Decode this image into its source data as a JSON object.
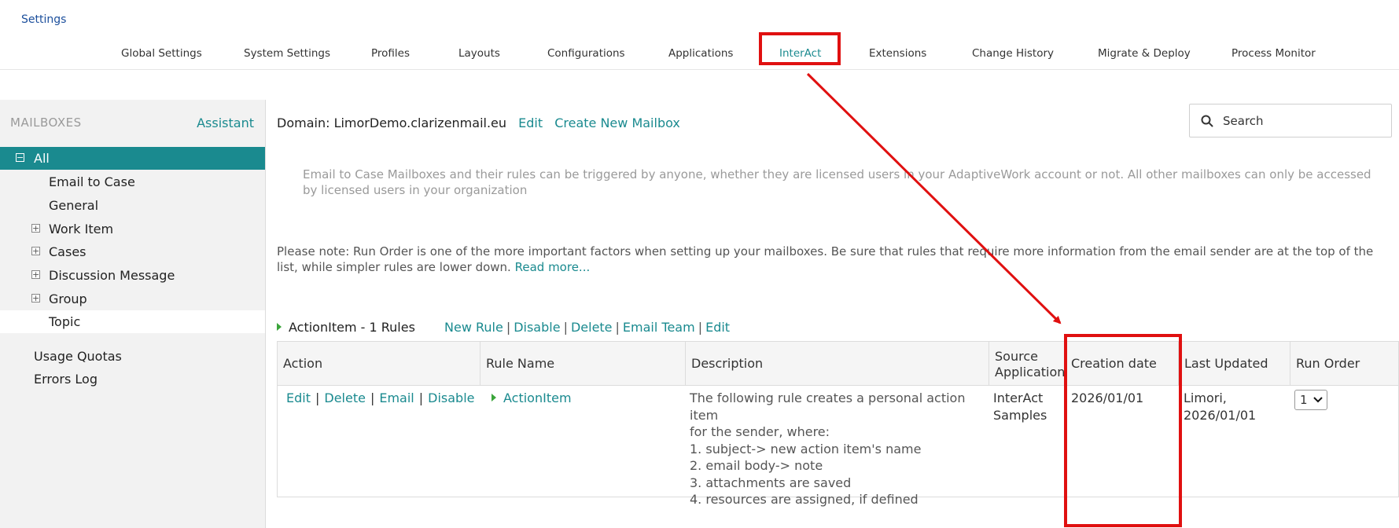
{
  "app": {
    "title": "Settings"
  },
  "top_nav": {
    "tabs": [
      {
        "label": "Global Settings"
      },
      {
        "label": "System Settings"
      },
      {
        "label": "Profiles"
      },
      {
        "label": "Layouts"
      },
      {
        "label": "Configurations"
      },
      {
        "label": "Applications"
      },
      {
        "label": "InterAct",
        "active": true
      },
      {
        "label": "Extensions"
      },
      {
        "label": "Change History"
      },
      {
        "label": "Migrate & Deploy"
      },
      {
        "label": "Process Monitor"
      }
    ]
  },
  "sidebar": {
    "header": "MAILBOXES",
    "assistant_label": "Assistant",
    "items": [
      {
        "label": "All",
        "toggle": "−",
        "active": true
      },
      {
        "label": "Email to Case"
      },
      {
        "label": "General"
      },
      {
        "label": "Work Item",
        "toggle": "+"
      },
      {
        "label": "Cases",
        "toggle": "+"
      },
      {
        "label": "Discussion Message",
        "toggle": "+"
      },
      {
        "label": "Group",
        "toggle": "+"
      },
      {
        "label": "Topic"
      }
    ],
    "extra_links": [
      {
        "label": "Usage Quotas"
      },
      {
        "label": "Errors Log"
      }
    ]
  },
  "main": {
    "domain_text": "Domain: LimorDemo.clarizenmail.eu",
    "edit_label": "Edit",
    "create_mailbox_label": "Create New Mailbox",
    "search": {
      "placeholder": "Search"
    },
    "info_text": "Email to Case Mailboxes and their rules can be triggered by anyone, whether they are licensed users in your AdaptiveWork account or not. All other mailboxes can only be accessed by licensed users in your organization",
    "note_text": "Please note: Run Order is one of the more important factors when setting up your mailboxes. Be sure that rules that require more information from the email sender are at the top of the list, while simpler rules are lower down.",
    "read_more_label": "Read more...",
    "rules_group": {
      "title": "ActionItem - 1 Rules",
      "actions": [
        "New Rule",
        "Disable",
        "Delete",
        "Email Team",
        "Edit"
      ]
    },
    "table": {
      "columns": [
        "Action",
        "Rule Name",
        "Description",
        "Source Application",
        "Creation date",
        "Last Updated",
        "Run Order"
      ],
      "rows": [
        {
          "actions": [
            "Edit",
            "Delete",
            "Email",
            "Disable"
          ],
          "rule_name": "ActionItem",
          "description": [
            "The following rule creates a personal action item",
            "for the sender, where:",
            "1. subject-> new action item's name",
            "2. email body-> note",
            "3. attachments are saved",
            "4. resources are assigned, if defined"
          ],
          "source_application": [
            "InterAct",
            "Samples"
          ],
          "creation_date": "2026/01/01",
          "last_updated": [
            "Limori,",
            "2026/01/01"
          ],
          "run_order": "1"
        }
      ]
    }
  },
  "annotations": {
    "highlight_color": "#e01010"
  },
  "colors": {
    "accent": "#1a8a8f",
    "title_blue": "#1c4f9c"
  }
}
